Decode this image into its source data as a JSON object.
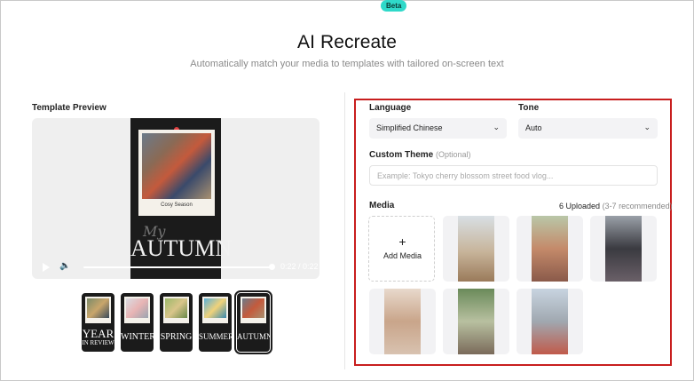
{
  "header": {
    "title": "AI Recreate",
    "badge": "Beta",
    "subtitle": "Automatically match your media to templates with tailored on-screen text"
  },
  "preview": {
    "label": "Template Preview",
    "polaroid_caption": "Cosy Season",
    "script_text": "My",
    "big_word": "AUTUMN",
    "time": "0:22 / 0:22",
    "progress": 1.0
  },
  "templates": [
    {
      "line1": "YEAR",
      "line2": "IN REVIEW"
    },
    {
      "line1": "WINTER",
      "line2": ""
    },
    {
      "line1": "SPRING",
      "line2": ""
    },
    {
      "line1": "SUMMER",
      "line2": ""
    },
    {
      "line1": "AUTUMN",
      "line2": ""
    }
  ],
  "form": {
    "language_label": "Language",
    "language_value": "Simplified Chinese",
    "tone_label": "Tone",
    "tone_value": "Auto",
    "theme_label": "Custom Theme",
    "theme_optional": "(Optional)",
    "theme_placeholder": "Example: Tokyo cherry blossom street food vlog...",
    "media_label": "Media",
    "uploaded_count": "6 Uploaded",
    "uploaded_rec": "(3-7 recommended)",
    "add_media": "Add Media",
    "plus": "+"
  },
  "icons": {
    "chevron": "⌄",
    "volume": "🔈"
  },
  "colors": {
    "highlight_border": "#c81e1e",
    "beta_badge": "#2fd9c9"
  }
}
